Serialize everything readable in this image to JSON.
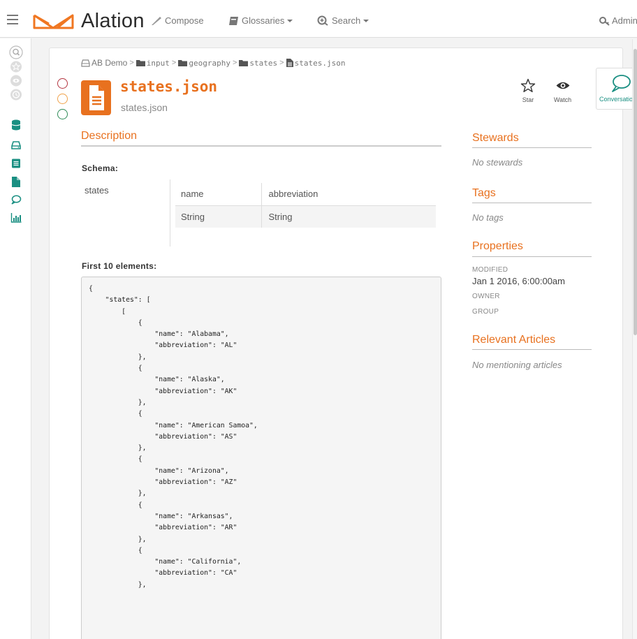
{
  "topbar": {
    "brand": "Alation",
    "nav": {
      "compose": "Compose",
      "glossaries": "Glossaries",
      "search": "Search"
    },
    "admin_label": "Admin",
    "brand_color": "#f07722"
  },
  "rail": {
    "icons": [
      "search-icon",
      "star-icon",
      "eye-icon",
      "clock-icon",
      "database-icon",
      "drive-icon",
      "table-icon",
      "file-icon",
      "conversation-icon",
      "chart-icon"
    ],
    "accent": "#1a8f82"
  },
  "breadcrumb": [
    "AB Demo",
    "input",
    "geography",
    "states",
    "states.json"
  ],
  "header": {
    "title": "states.json",
    "subtitle": "states.json",
    "trust_colors": [
      "#b3343f",
      "#f0a24a",
      "#2e8b57"
    ]
  },
  "actions": {
    "star": "Star",
    "watch": "Watch",
    "conversations": "Conversations"
  },
  "description": {
    "heading": "Description",
    "schema_label": "Schema:",
    "schema_name": "states",
    "schema_table": [
      [
        "name",
        "abbreviation"
      ],
      [
        "String",
        "String"
      ]
    ],
    "first_label": "First 10 elements:",
    "code": "{\n    \"states\": [\n        [\n            {\n                \"name\": \"Alabama\",\n                \"abbreviation\": \"AL\"\n            },\n            {\n                \"name\": \"Alaska\",\n                \"abbreviation\": \"AK\"\n            },\n            {\n                \"name\": \"American Samoa\",\n                \"abbreviation\": \"AS\"\n            },\n            {\n                \"name\": \"Arizona\",\n                \"abbreviation\": \"AZ\"\n            },\n            {\n                \"name\": \"Arkansas\",\n                \"abbreviation\": \"AR\"\n            },\n            {\n                \"name\": \"California\",\n                \"abbreviation\": \"CA\"\n            },"
  },
  "sidebar": {
    "stewards": {
      "heading": "Stewards",
      "empty": "No stewards"
    },
    "tags": {
      "heading": "Tags",
      "empty": "No tags"
    },
    "properties": {
      "heading": "Properties",
      "modified_label": "MODIFIED",
      "modified_value": "Jan 1 2016, 6:00:00am",
      "owner_label": "OWNER",
      "group_label": "GROUP"
    },
    "articles": {
      "heading": "Relevant Articles",
      "empty": "No mentioning articles"
    }
  }
}
